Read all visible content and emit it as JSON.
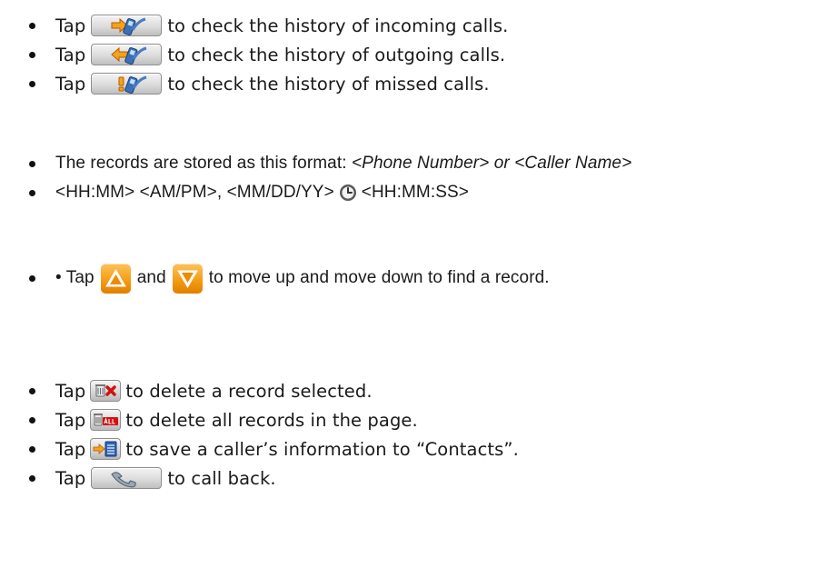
{
  "history_buttons": [
    {
      "prefix": "Tap",
      "icon": "incoming-call-icon",
      "suffix": "to check the history of incoming calls."
    },
    {
      "prefix": "Tap",
      "icon": "outgoing-call-icon",
      "suffix": "to check the history of outgoing calls."
    },
    {
      "prefix": "Tap",
      "icon": "missed-call-icon",
      "suffix": "to check the history of missed calls."
    }
  ],
  "format": {
    "line1_prefix": "The records are stored as this format: ",
    "line1_italic": "<Phone Number> or <Caller Name>",
    "line2_prefix": "<HH:MM> <AM/PM>, <MM/DD/YY>",
    "line2_suffix": "<HH:MM:SS>"
  },
  "navigation": {
    "prefix": "• Tap",
    "middle": "and",
    "suffix": "to move up and move down to find a record."
  },
  "actions": [
    {
      "prefix": "Tap",
      "icon": "delete-record-icon",
      "suffix": "to delete a record selected."
    },
    {
      "prefix": "Tap",
      "icon": "delete-all-icon",
      "suffix": "to delete all records in the page."
    },
    {
      "prefix": "Tap",
      "icon": "save-to-contacts-icon",
      "suffix": "to save a caller’s information to “Contacts”."
    },
    {
      "prefix": "Tap",
      "icon": "call-back-icon",
      "suffix": "to call back."
    }
  ],
  "colors": {
    "button_orange": "#f39a10",
    "arrow_orange": "#f08a00",
    "delete_red": "#d41010"
  }
}
